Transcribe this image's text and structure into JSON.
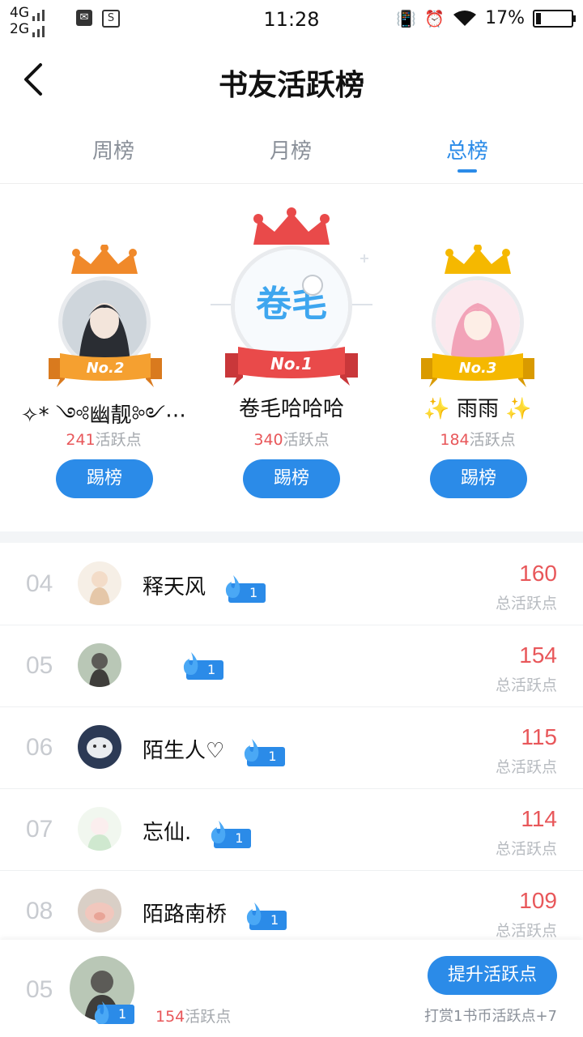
{
  "status_bar": {
    "network_1": "4G",
    "network_2": "2G",
    "time": "11:28",
    "battery": "17%",
    "battery_level": 0.17
  },
  "header": {
    "title": "书友活跃榜"
  },
  "tabs": [
    {
      "label": "周榜",
      "active": false
    },
    {
      "label": "月榜",
      "active": false
    },
    {
      "label": "总榜",
      "active": true
    }
  ],
  "podium": {
    "first": {
      "ribbon": "No.1",
      "name": "卷毛哈哈哈",
      "points": "340",
      "points_suffix": "活跃点",
      "button": "踢榜",
      "avatar_text": "卷毛"
    },
    "second": {
      "ribbon": "No.2",
      "name": "✧* ༺幽靓༻⋯",
      "points": "241",
      "points_suffix": "活跃点",
      "button": "踢榜"
    },
    "third": {
      "ribbon": "No.3",
      "name": "✨ 雨雨 ✨",
      "points": "184",
      "points_suffix": "活跃点",
      "button": "踢榜"
    }
  },
  "list": {
    "score_label": "总活跃点",
    "rows": [
      {
        "rank": "04",
        "name": "释天风",
        "level": "1",
        "score": "160"
      },
      {
        "rank": "05",
        "name": "",
        "level": "1",
        "score": "154"
      },
      {
        "rank": "06",
        "name": "陌生人♡",
        "level": "1",
        "score": "115"
      },
      {
        "rank": "07",
        "name": "忘仙.",
        "level": "1",
        "score": "114"
      },
      {
        "rank": "08",
        "name": "陌路南桥",
        "level": "1",
        "score": "109"
      }
    ]
  },
  "me": {
    "rank": "05",
    "level": "1",
    "points": "154",
    "points_suffix": "活跃点",
    "boost_button": "提升活跃点",
    "tip": "打赏1书币活跃点+7"
  },
  "colors": {
    "accent": "#2b8be8",
    "score": "#e8575a",
    "gold": "#f5b800",
    "silver_crown": "#f0892a",
    "first_crown": "#e94a4a"
  }
}
